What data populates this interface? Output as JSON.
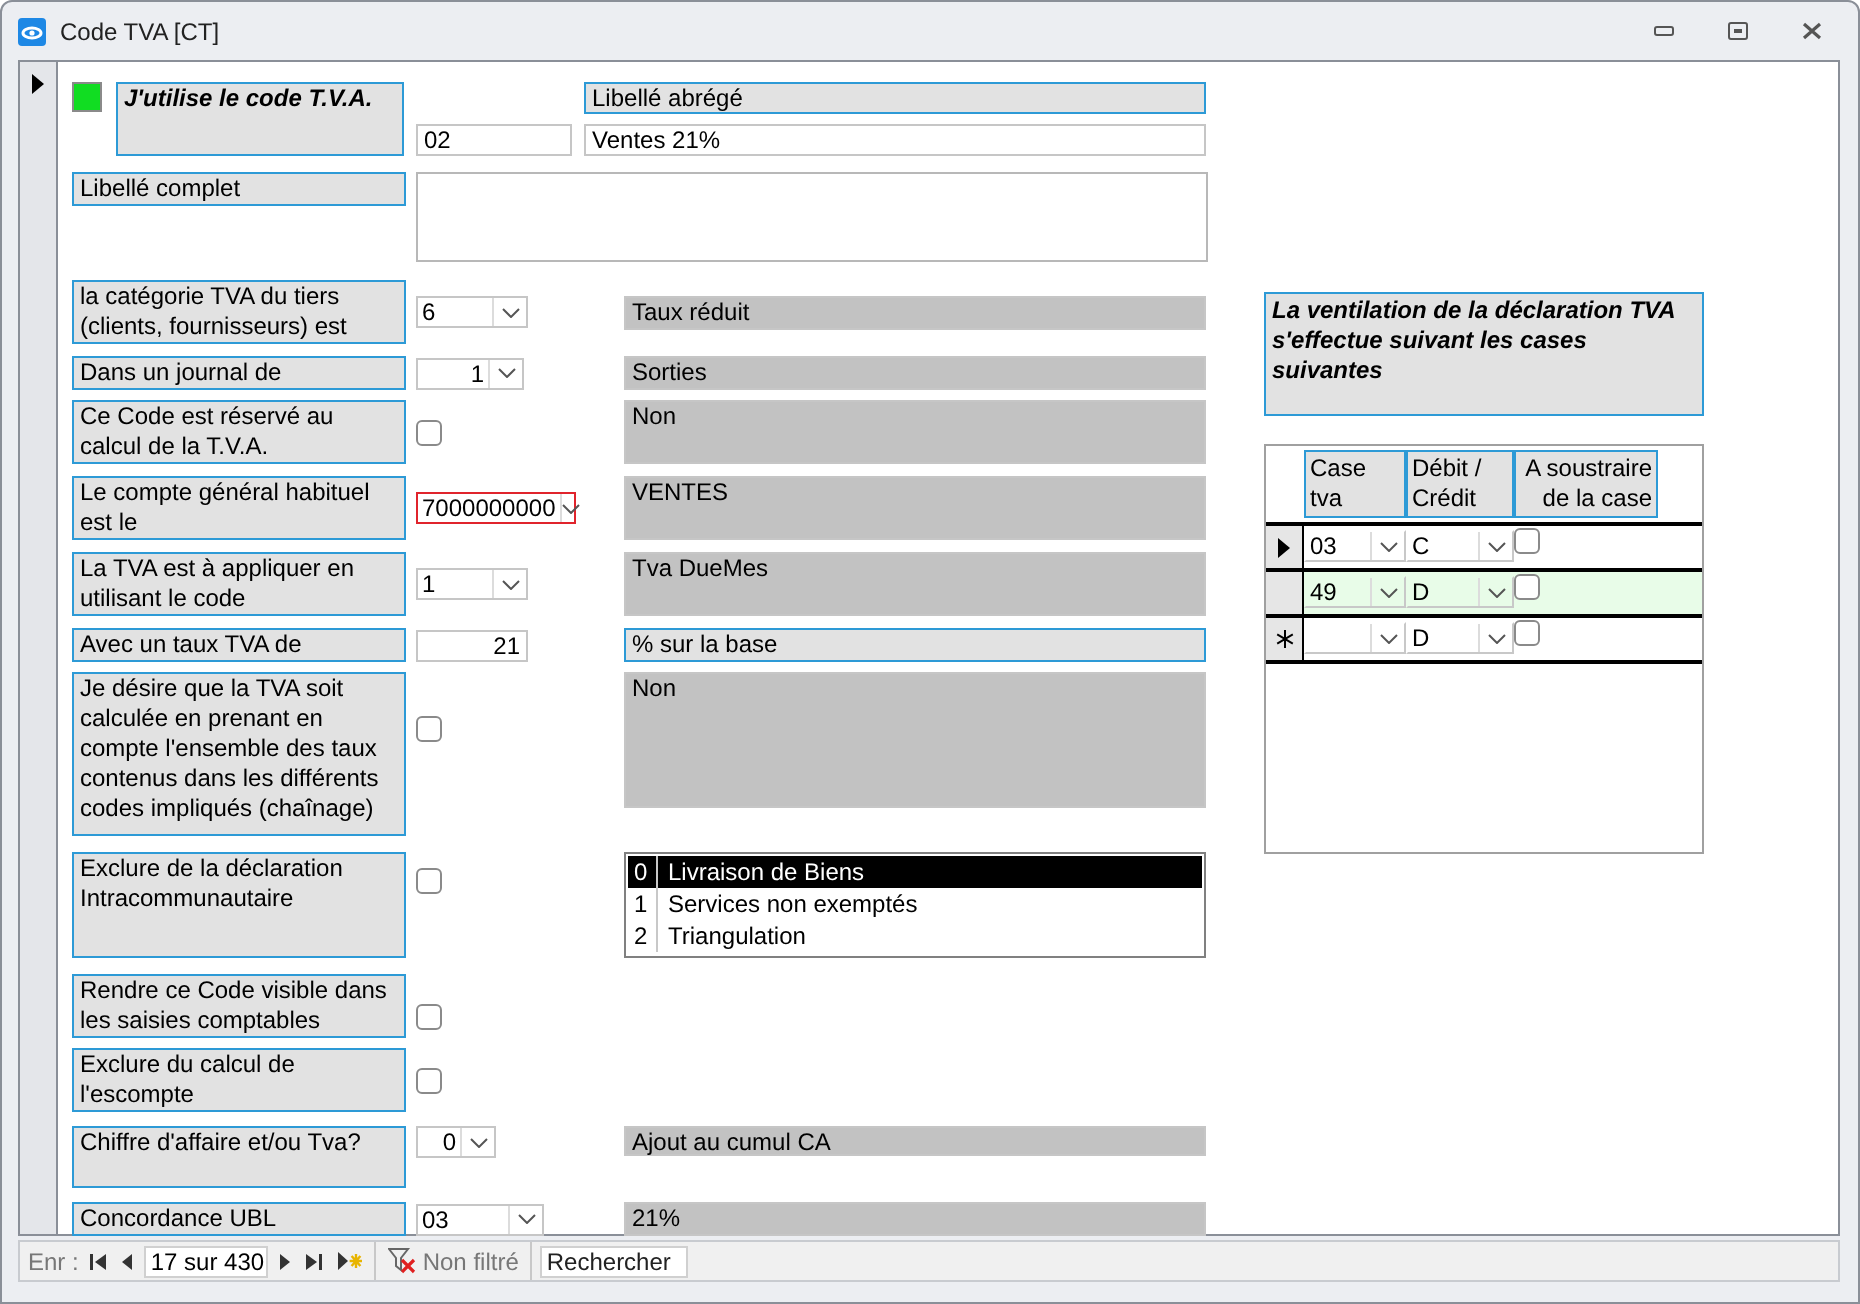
{
  "window": {
    "title": "Code TVA [CT]"
  },
  "header": {
    "active": true,
    "label": "J'utilise le code T.V.A.",
    "short_label_caption": "Libellé abrégé",
    "code": "02",
    "short_label": "Ventes 21%"
  },
  "full_label": {
    "label": "Libellé complet"
  },
  "fields": [
    {
      "label": "la catégorie TVA du tiers (clients, fournisseurs) est",
      "kind": "select",
      "value": "6",
      "right_aligned": false,
      "focused": false,
      "result_outlined": false,
      "result": "Taux réduit"
    },
    {
      "label": "Dans un journal de",
      "kind": "select",
      "value": "1",
      "right_aligned": true,
      "focused": false,
      "result_outlined": false,
      "result": "Sorties"
    },
    {
      "label": "Ce Code est réservé au calcul de la T.V.A.",
      "kind": "checkbox",
      "checked": false,
      "result_outlined": false,
      "result": "Non"
    },
    {
      "label": "Le compte général habituel est le",
      "kind": "select",
      "value": "7000000000",
      "right_aligned": false,
      "focused": true,
      "result_outlined": false,
      "result": "VENTES"
    },
    {
      "label": "La TVA est à appliquer en utilisant le code",
      "kind": "select",
      "value": "1",
      "right_aligned": false,
      "focused": false,
      "result_outlined": false,
      "result": "Tva DueMes"
    },
    {
      "label": "Avec un taux TVA de",
      "kind": "input",
      "value": "21",
      "right_aligned": true,
      "focused": false,
      "result_outlined": true,
      "result": "% sur la base"
    },
    {
      "label": "Je désire que la TVA soit calculée en prenant en compte l'ensemble des taux contenus dans les différents codes impliqués (chaînage)",
      "kind": "checkbox",
      "checked": false,
      "result_outlined": false,
      "result": "Non"
    },
    {
      "label": "Exclure de la déclaration Intracommunautaire",
      "kind": "checkbox",
      "checked": false,
      "options": [
        {
          "code": "0",
          "text": "Livraison de Biens",
          "selected": true
        },
        {
          "code": "1",
          "text": "Services non exemptés",
          "selected": false
        },
        {
          "code": "2",
          "text": "Triangulation",
          "selected": false
        }
      ]
    },
    {
      "label": "Rendre ce Code visible dans les saisies comptables",
      "kind": "checkbox",
      "checked": false
    },
    {
      "label": "Exclure du calcul de l'escompte",
      "kind": "checkbox",
      "checked": false
    },
    {
      "label": "Chiffre d'affaire et/ou Tva?",
      "kind": "select",
      "value": "0",
      "right_aligned": true,
      "focused": false,
      "result_outlined": false,
      "result": "Ajout au cumul CA"
    },
    {
      "label": "Concordance UBL",
      "kind": "select",
      "value": "03",
      "right_aligned": false,
      "focused": false,
      "result_outlined": false,
      "result": "21%"
    }
  ],
  "ventilation": {
    "caption": "La ventilation de la déclaration TVA s'effectue suivant les cases suivantes",
    "columns": [
      "Case tva",
      "Débit / Crédit",
      "A soustraire de la case"
    ],
    "rows": [
      {
        "kind": "current",
        "case": "03",
        "side": "C",
        "subtract": false,
        "highlighted": false
      },
      {
        "kind": "normal",
        "case": "49",
        "side": "D",
        "subtract": false,
        "highlighted": true
      },
      {
        "kind": "new",
        "side": "D",
        "subtract": false,
        "highlighted": false
      }
    ]
  },
  "status_bar": {
    "label": "Enr :",
    "position": "17 sur 430",
    "filter": "Non filtré",
    "search_placeholder": "Rechercher"
  }
}
